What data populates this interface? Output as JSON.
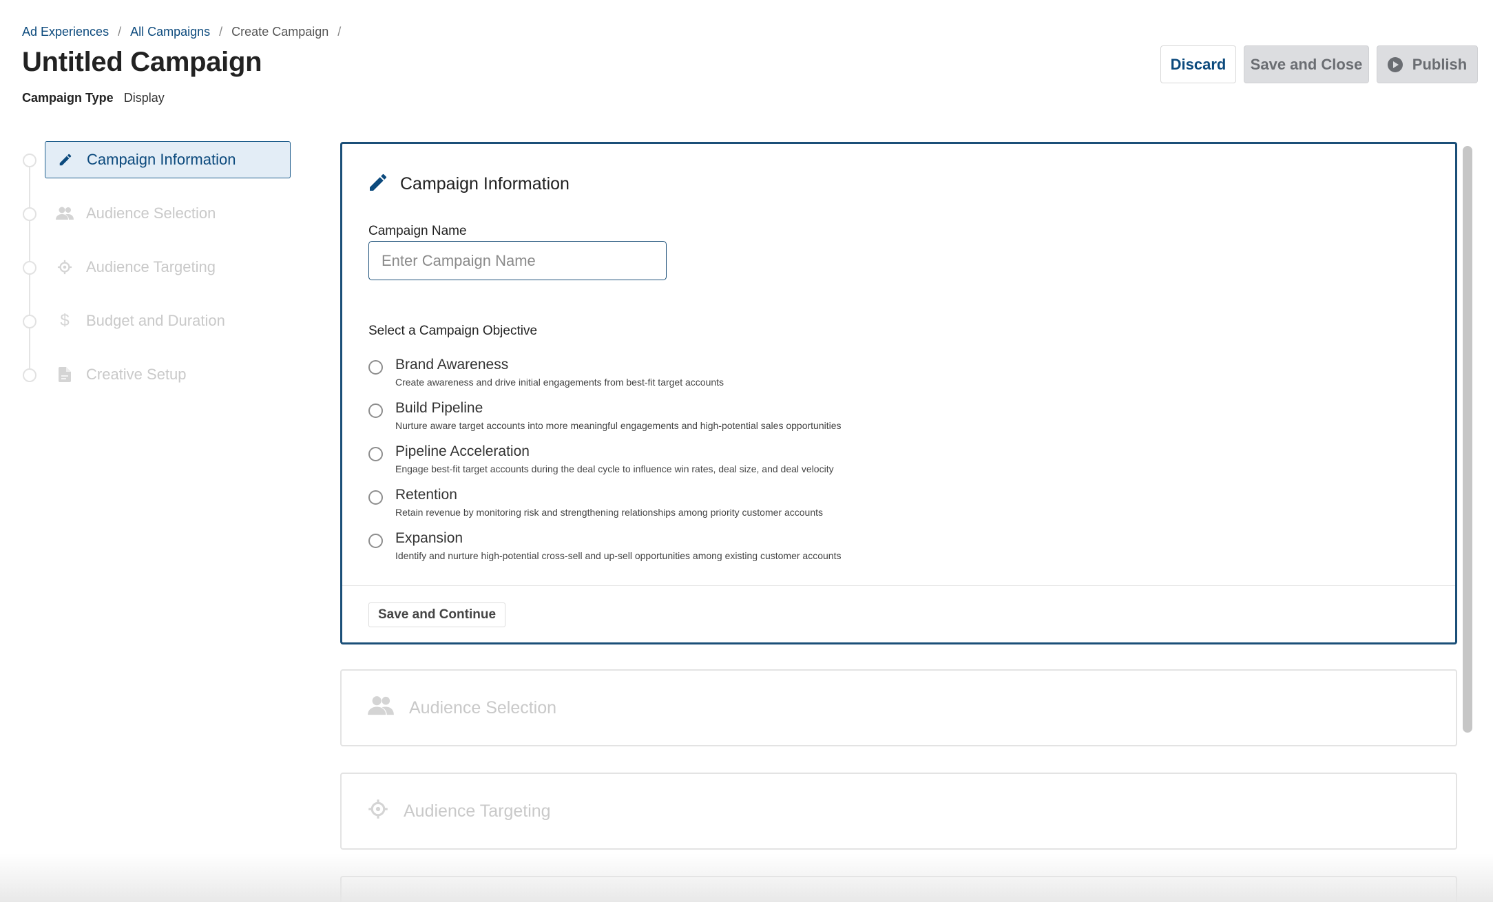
{
  "breadcrumb": {
    "items": [
      "Ad Experiences",
      "All Campaigns",
      "Create Campaign"
    ],
    "separator": "/"
  },
  "page": {
    "title": "Untitled Campaign",
    "campaign_type_label": "Campaign Type",
    "campaign_type_value": "Display"
  },
  "actions": {
    "discard": "Discard",
    "save_close": "Save and Close",
    "publish": "Publish"
  },
  "stepper": {
    "steps": [
      {
        "label": "Campaign Information",
        "icon": "pencil-icon",
        "active": true
      },
      {
        "label": "Audience Selection",
        "icon": "people-icon",
        "active": false
      },
      {
        "label": "Audience Targeting",
        "icon": "crosshair-icon",
        "active": false
      },
      {
        "label": "Budget and Duration",
        "icon": "dollar-icon",
        "active": false
      },
      {
        "label": "Creative Setup",
        "icon": "document-icon",
        "active": false
      }
    ]
  },
  "main_card": {
    "title": "Campaign Information",
    "icon": "pencil-icon",
    "name_label": "Campaign Name",
    "name_placeholder": "Enter Campaign Name",
    "name_value": "",
    "objective_label": "Select a Campaign Objective",
    "objectives": [
      {
        "title": "Brand Awareness",
        "desc": "Create awareness and drive initial engagements from best-fit target accounts"
      },
      {
        "title": "Build Pipeline",
        "desc": "Nurture aware target accounts into more meaningful engagements and high-potential sales opportunities"
      },
      {
        "title": "Pipeline Acceleration",
        "desc": "Engage best-fit target accounts during the deal cycle to influence win rates, deal size, and deal velocity"
      },
      {
        "title": "Retention",
        "desc": "Retain revenue by monitoring risk and strengthening relationships among priority customer accounts"
      },
      {
        "title": "Expansion",
        "desc": "Identify and nurture high-potential cross-sell and up-sell opportunities among existing customer accounts"
      }
    ],
    "continue_button": "Save and Continue"
  },
  "collapsed_cards": [
    {
      "title": "Audience Selection",
      "icon": "people-icon"
    },
    {
      "title": "Audience Targeting",
      "icon": "crosshair-icon"
    }
  ],
  "colors": {
    "accent": "#0c4a7d",
    "border_active": "#1b4f78",
    "disabled_text": "#c9c9c9",
    "active_step_bg": "#e3edf6"
  }
}
